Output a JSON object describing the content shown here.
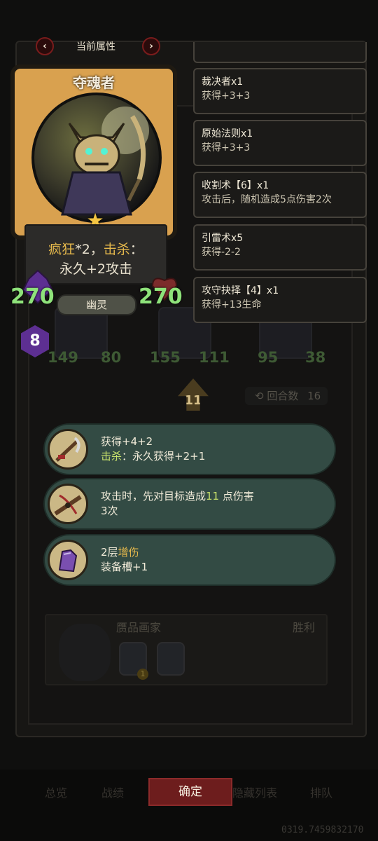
{
  "nav": {
    "title": "当前属性",
    "prev": "‹",
    "next": "›"
  },
  "hero": {
    "name": "夺魂者",
    "desc_kw1": "疯狂",
    "desc_mid": "*2，",
    "desc_kw2": "击杀",
    "desc_colon": "：",
    "desc_line2": "永久+2攻击",
    "attack": "270",
    "health": "270",
    "tribe": "幽灵",
    "level": "8",
    "star": "★"
  },
  "items": [
    {
      "name": "裁决者x1",
      "desc": "获得+3+3"
    },
    {
      "name": "原始法则x1",
      "desc": "获得+3+3"
    },
    {
      "name": "收割术【6】x1",
      "desc": "攻击后，随机造成5点伤害2次"
    },
    {
      "name": "引雷术x5",
      "desc": "获得-2-2"
    },
    {
      "name": "攻守抉择【4】x1",
      "desc": "获得+13生命"
    }
  ],
  "background_team": {
    "units": [
      {
        "attack": "149",
        "health": "80"
      },
      {
        "attack": "155",
        "health": "111"
      },
      {
        "attack": "95",
        "health": "38"
      }
    ],
    "arrow_value": "11",
    "round_label": "回合数",
    "round_value": "16"
  },
  "skills": [
    {
      "line1": "获得+4+2",
      "kw": "击杀",
      "line2_rest": "：永久获得+2+1"
    },
    {
      "line1_pre": "攻击时，先对目标造成",
      "line1_num": "11",
      "line1_post": "点伤害",
      "line2": "3次"
    },
    {
      "line1_num": "2层",
      "line1_kw": "增伤",
      "line2": "装备槽+1"
    }
  ],
  "foe": {
    "name": "赝品画家",
    "result": "胜利",
    "chip_value": "1"
  },
  "tabs": {
    "t1": "总览",
    "t2": "战绩",
    "confirm": "确定",
    "t4": "隐藏列表",
    "t5": "排队"
  },
  "seed": "0319.7459832170",
  "colors": {
    "accent_red": "#6d1d1d",
    "stat_green": "#8ee27a",
    "keyword_gold": "#e6b94c",
    "pill_teal": "#334b44"
  }
}
